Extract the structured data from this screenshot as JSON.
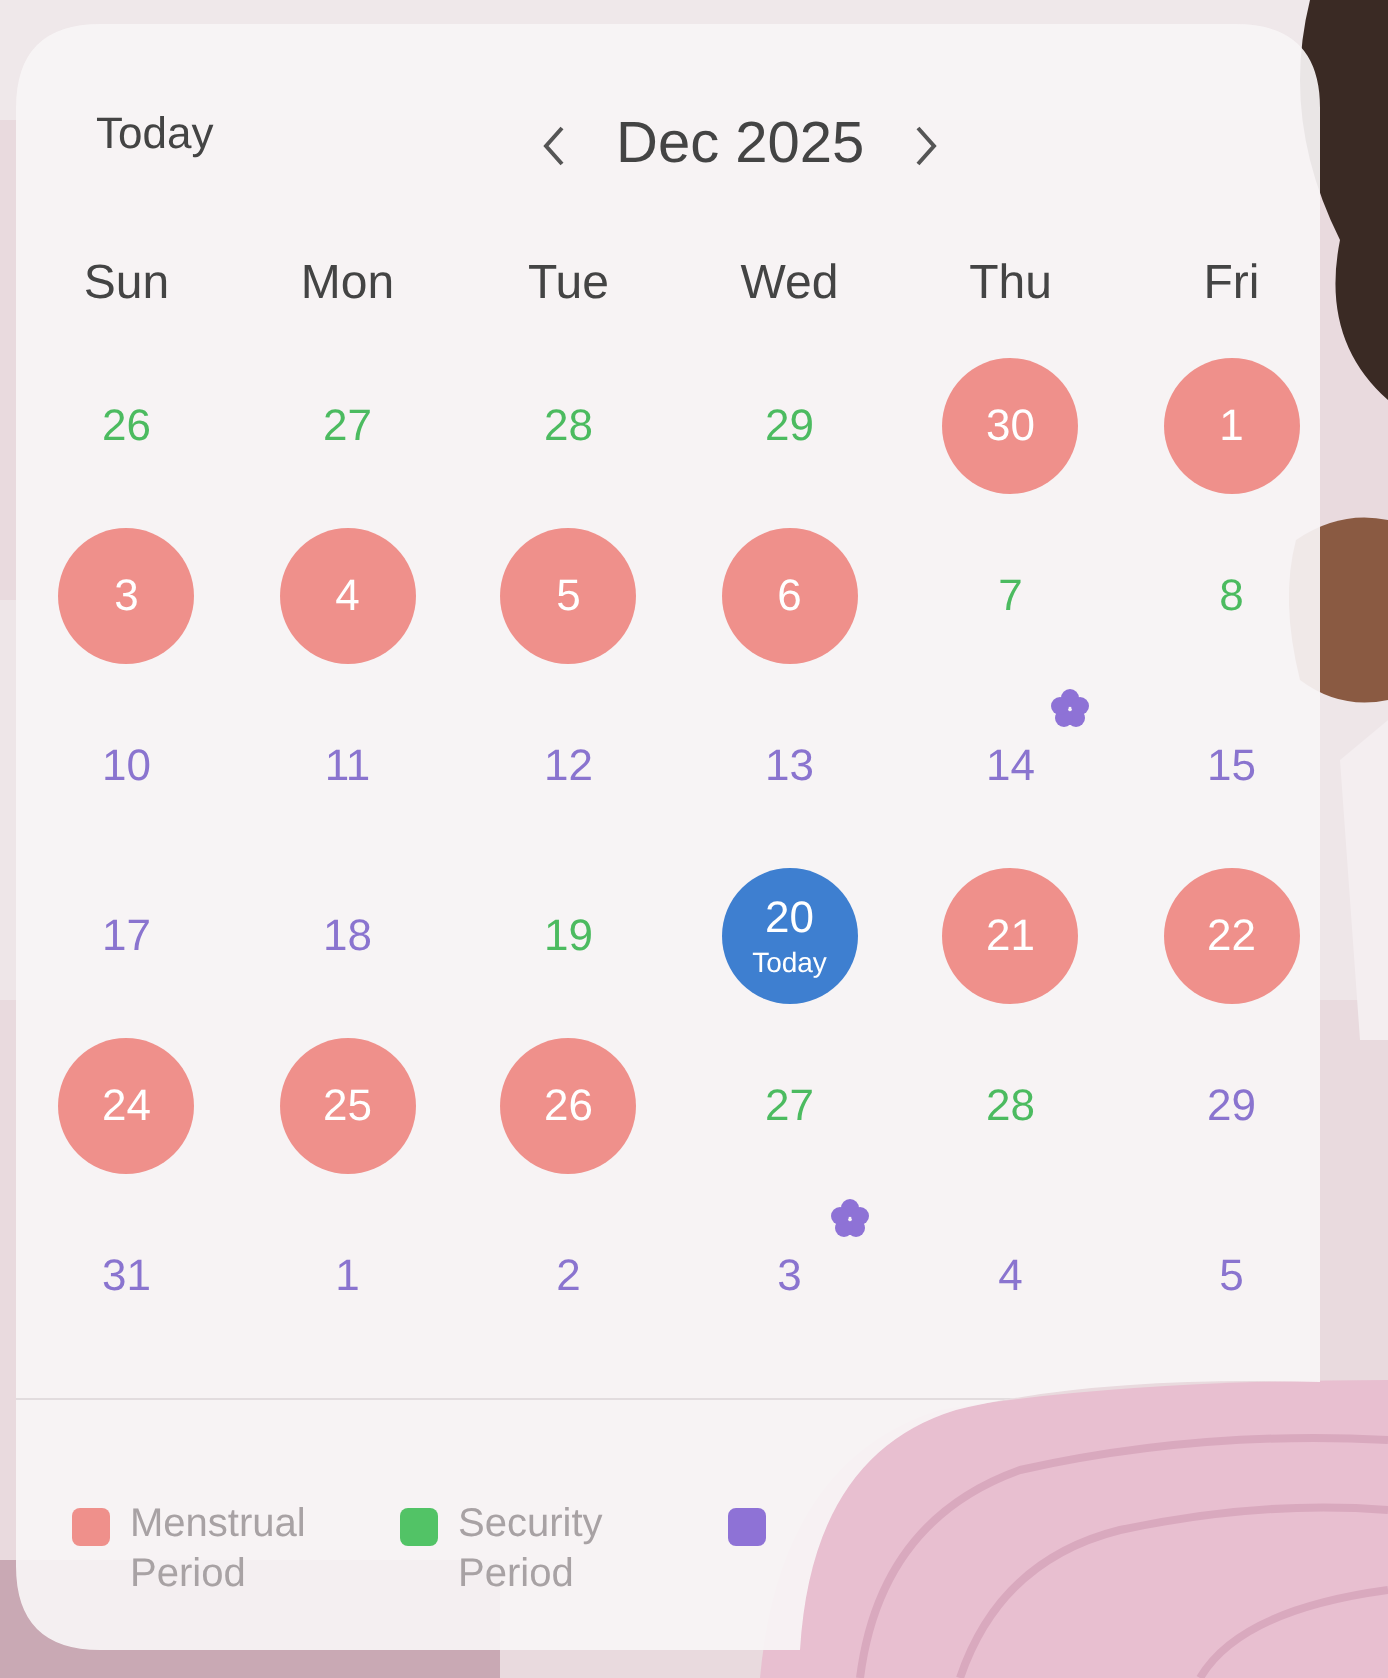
{
  "header": {
    "today_button": "Today",
    "title": "Dec 2025"
  },
  "weekdays": [
    "Sun",
    "Mon",
    "Tue",
    "Wed",
    "Thu",
    "Fri"
  ],
  "weeks": [
    [
      {
        "day": "26",
        "kind": "safe",
        "flower": false
      },
      {
        "day": "27",
        "kind": "safe",
        "flower": false
      },
      {
        "day": "28",
        "kind": "safe",
        "flower": false
      },
      {
        "day": "29",
        "kind": "safe",
        "flower": false
      },
      {
        "day": "30",
        "kind": "period",
        "flower": false
      },
      {
        "day": "1",
        "kind": "period",
        "flower": false
      }
    ],
    [
      {
        "day": "3",
        "kind": "period",
        "flower": false
      },
      {
        "day": "4",
        "kind": "period",
        "flower": false
      },
      {
        "day": "5",
        "kind": "period",
        "flower": false
      },
      {
        "day": "6",
        "kind": "period",
        "flower": false
      },
      {
        "day": "7",
        "kind": "safe",
        "flower": false
      },
      {
        "day": "8",
        "kind": "safe",
        "flower": false
      }
    ],
    [
      {
        "day": "10",
        "kind": "normal",
        "flower": false
      },
      {
        "day": "11",
        "kind": "normal",
        "flower": false
      },
      {
        "day": "12",
        "kind": "normal",
        "flower": false
      },
      {
        "day": "13",
        "kind": "normal",
        "flower": false
      },
      {
        "day": "14",
        "kind": "normal",
        "flower": true
      },
      {
        "day": "15",
        "kind": "normal",
        "flower": false
      }
    ],
    [
      {
        "day": "17",
        "kind": "normal",
        "flower": false
      },
      {
        "day": "18",
        "kind": "normal",
        "flower": false
      },
      {
        "day": "19",
        "kind": "safe",
        "flower": false
      },
      {
        "day": "20",
        "kind": "today",
        "sublabel": "Today",
        "flower": false
      },
      {
        "day": "21",
        "kind": "period",
        "flower": false
      },
      {
        "day": "22",
        "kind": "period",
        "flower": false
      }
    ],
    [
      {
        "day": "24",
        "kind": "period",
        "flower": false
      },
      {
        "day": "25",
        "kind": "period",
        "flower": false
      },
      {
        "day": "26",
        "kind": "period",
        "flower": false
      },
      {
        "day": "27",
        "kind": "safe",
        "flower": false
      },
      {
        "day": "28",
        "kind": "safe",
        "flower": false
      },
      {
        "day": "29",
        "kind": "normal",
        "flower": false
      }
    ],
    [
      {
        "day": "31",
        "kind": "normal",
        "flower": false
      },
      {
        "day": "1",
        "kind": "normal",
        "flower": false
      },
      {
        "day": "2",
        "kind": "normal",
        "flower": false
      },
      {
        "day": "3",
        "kind": "normal",
        "flower": true
      },
      {
        "day": "4",
        "kind": "normal",
        "flower": false
      },
      {
        "day": "5",
        "kind": "normal",
        "flower": false
      }
    ]
  ],
  "legend": [
    {
      "label": "Menstrual Period",
      "color": "#ef908b"
    },
    {
      "label": "Security Period",
      "color": "#52c366"
    },
    {
      "color": "#8e72d6"
    }
  ]
}
